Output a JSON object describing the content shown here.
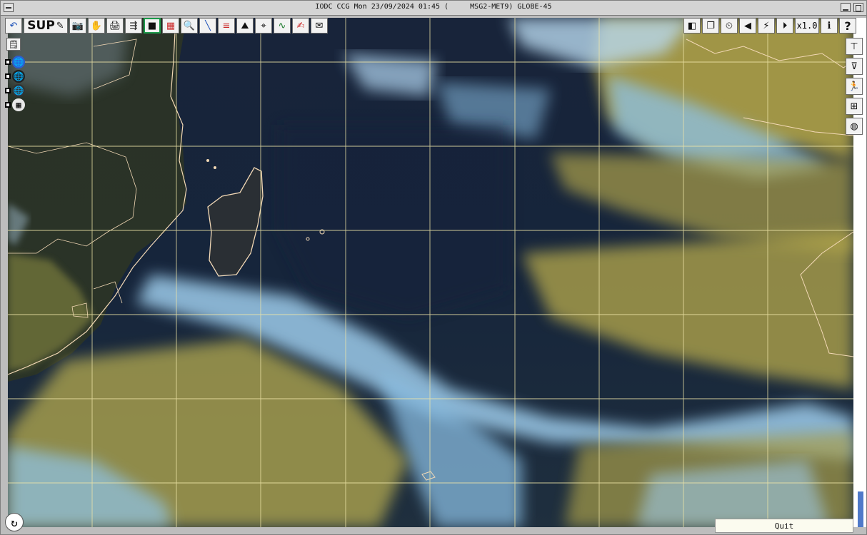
{
  "window": {
    "title": "IODC CCG Mon 23/09/2024 01:45 (     MSG2-MET9) GLOBE-45"
  },
  "toolbar_left": {
    "back": "↶",
    "sup": "SUP",
    "sup_icon": "✎",
    "camera": "📷",
    "hand": "✋",
    "print": "🖨",
    "export": "⇶",
    "frame_black": "■",
    "frame_red": "▦",
    "zoom": "🔍",
    "line": "╲",
    "grid_lines": "≡",
    "terrain": "⛰",
    "target": "⌖",
    "curve": "∿",
    "palette": "✍",
    "doc": "✉"
  },
  "toolbar_right": {
    "contrast": "◧",
    "layers": "❐",
    "timer": "⏲",
    "prev": "◀",
    "pause": "⚡",
    "next": "⏵",
    "zoom_level": "x1.0",
    "info": "i",
    "help": "?"
  },
  "sidebar_left": {
    "note_icon": "🗒",
    "layers": [
      {
        "icon": "🌐",
        "checked": false
      },
      {
        "icon": "🌐",
        "checked": false
      },
      {
        "icon": "🌐",
        "checked": false
      },
      {
        "icon": "▦",
        "checked": false
      }
    ]
  },
  "sidebar_right": {
    "filter1": "⊤",
    "filter2": "⊽",
    "run": "🏃",
    "grid": "⊞",
    "palette": "◍"
  },
  "footer": {
    "quit_label": "Quit",
    "loop_icon": "↻"
  },
  "colors": {
    "ocean": "#13233b",
    "cloud_yellow": "#b8aa4c",
    "cloud_blue": "#8ec4ea",
    "coast": "#f3d9b6",
    "grid": "#efe6a8",
    "accent_green": "#1c9a4a",
    "scroll_thumb": "#4f79c9"
  }
}
